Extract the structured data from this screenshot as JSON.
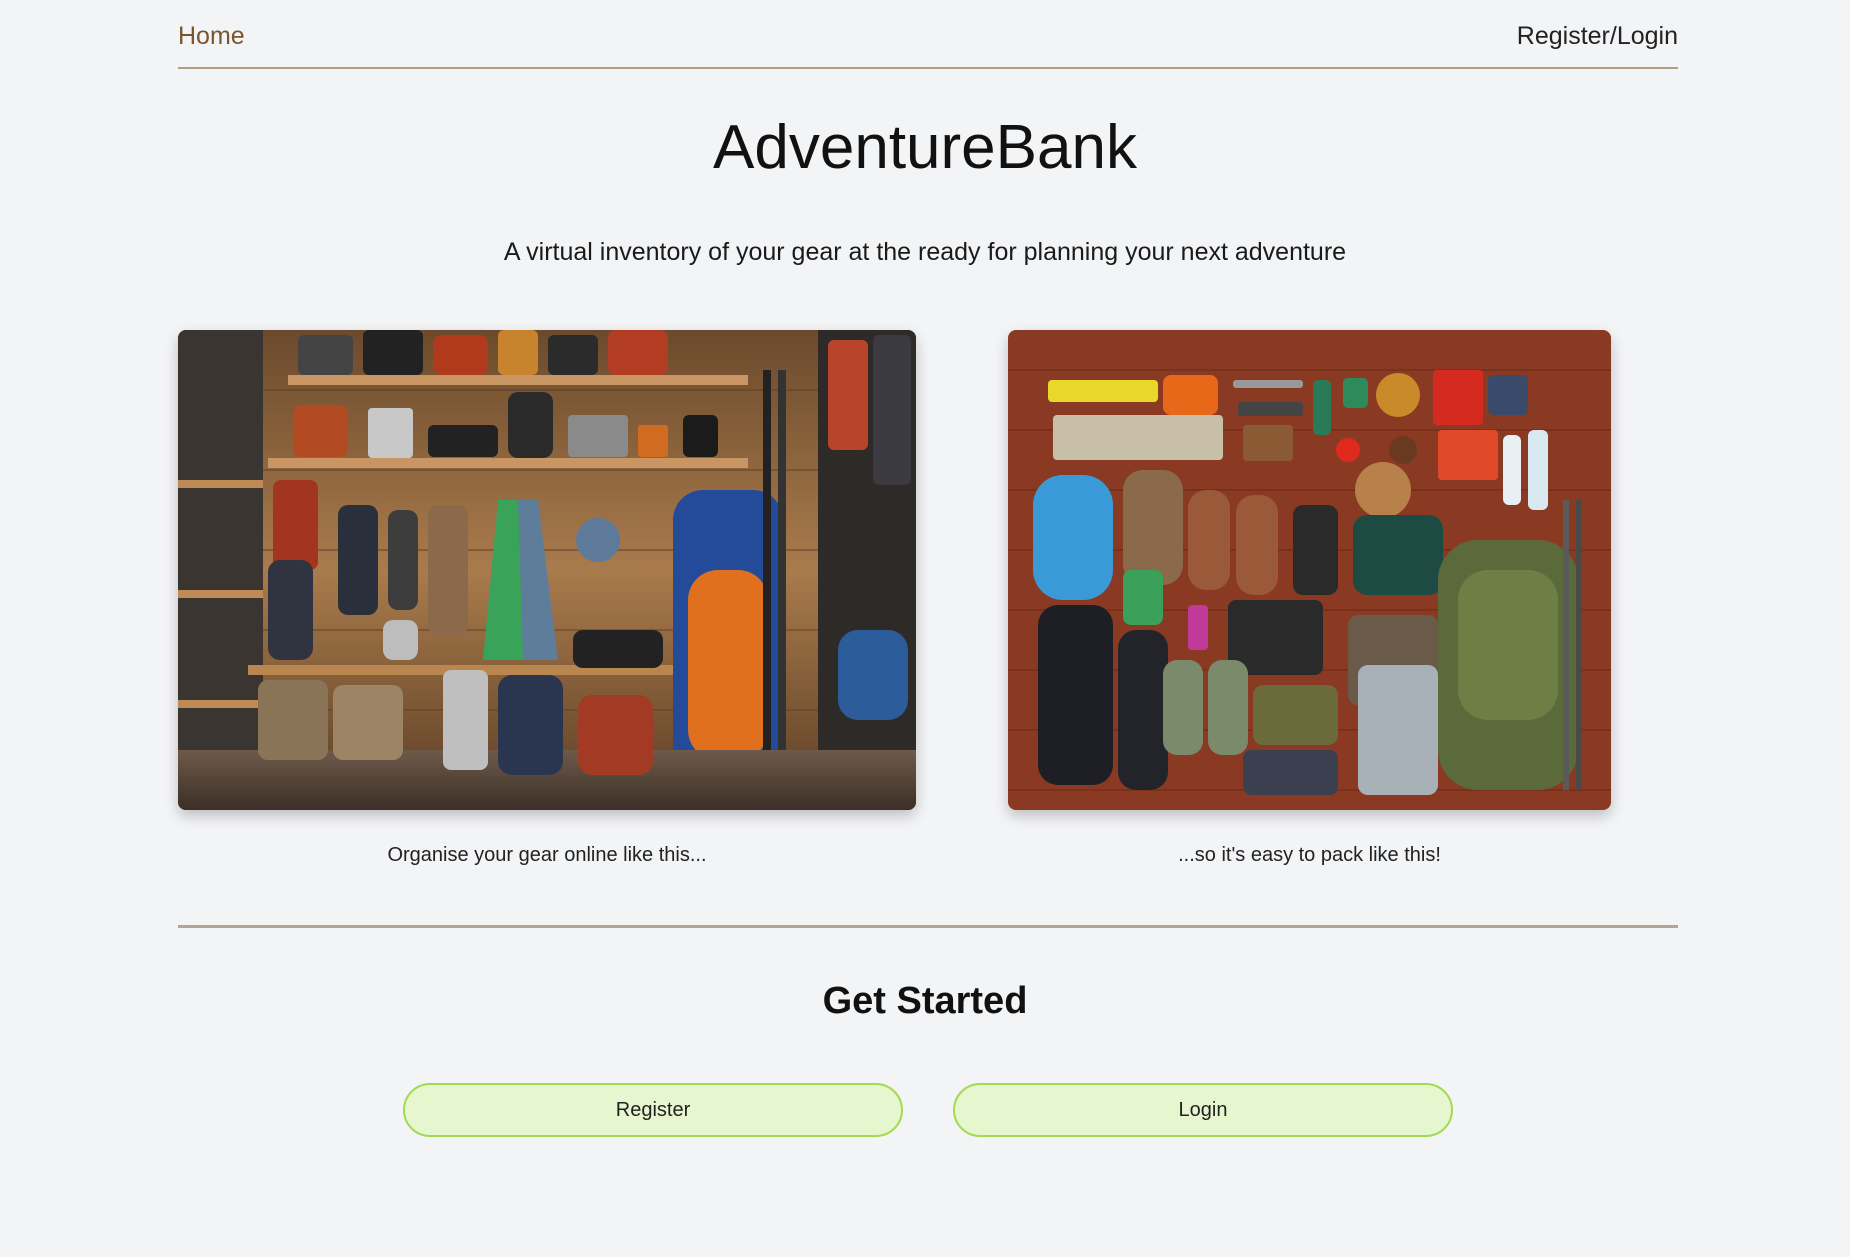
{
  "nav": {
    "home_label": "Home",
    "register_login_label": "Register/Login"
  },
  "hero": {
    "title": "AdventureBank",
    "subtitle": "A virtual inventory of your gear at the ready for planning your next adventure"
  },
  "gallery": {
    "left_caption": "Organise your gear online like this...",
    "right_caption": "...so it's easy to pack like this!"
  },
  "get_started": {
    "title": "Get Started",
    "register_label": "Register",
    "login_label": "Login"
  },
  "colors": {
    "background": "#f3f4f6",
    "nav_home": "#7a5630",
    "divider": "#b8a48e",
    "button_bg": "#e6f7cf",
    "button_border": "#a3d94f"
  }
}
